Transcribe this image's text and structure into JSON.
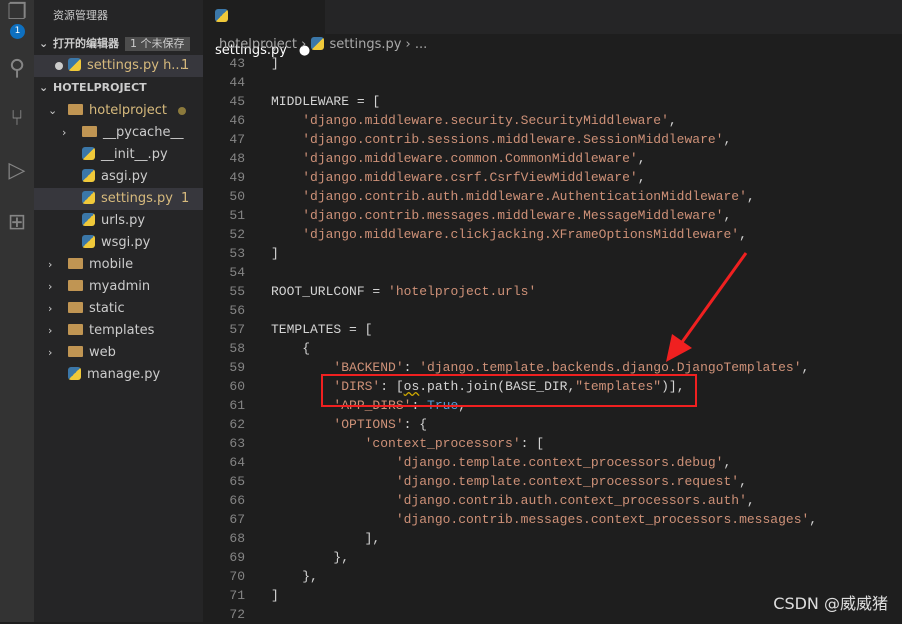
{
  "activity": {
    "badge": "1",
    "icons": [
      "files-icon",
      "search-icon",
      "source-control-icon",
      "run-debug-icon",
      "extensions-icon"
    ]
  },
  "explorer": {
    "title": "资源管理器",
    "open_editors": {
      "label": "打开的编辑器",
      "unsaved": "1 个未保存",
      "items": [
        {
          "name": "settings.py",
          "path": "h...",
          "problems": "1"
        }
      ]
    },
    "project": "HOTELPROJECT",
    "tree": [
      {
        "name": "hotelproject",
        "type": "folder",
        "open": true,
        "depth": 1,
        "modified": true
      },
      {
        "name": "__pycache__",
        "type": "folder",
        "open": false,
        "depth": 2
      },
      {
        "name": "__init__.py",
        "type": "py",
        "depth": 2
      },
      {
        "name": "asgi.py",
        "type": "py",
        "depth": 2
      },
      {
        "name": "settings.py",
        "type": "py",
        "depth": 2,
        "problems": "1",
        "selected": true
      },
      {
        "name": "urls.py",
        "type": "py",
        "depth": 2
      },
      {
        "name": "wsgi.py",
        "type": "py",
        "depth": 2
      },
      {
        "name": "mobile",
        "type": "folder",
        "open": false,
        "depth": 1
      },
      {
        "name": "myadmin",
        "type": "folder",
        "open": false,
        "depth": 1
      },
      {
        "name": "static",
        "type": "folder",
        "open": false,
        "depth": 1
      },
      {
        "name": "templates",
        "type": "folder",
        "open": false,
        "depth": 1
      },
      {
        "name": "web",
        "type": "folder",
        "open": false,
        "depth": 1
      },
      {
        "name": "manage.py",
        "type": "py",
        "depth": 1
      }
    ]
  },
  "tab": {
    "name": "settings.py"
  },
  "breadcrumb": [
    "hotelproject",
    "settings.py",
    "..."
  ],
  "code": [
    {
      "n": "43",
      "t": [
        [
          "",
          "]"
        ]
      ]
    },
    {
      "n": "44",
      "t": []
    },
    {
      "n": "45",
      "t": [
        [
          "",
          "MIDDLEWARE = ["
        ]
      ]
    },
    {
      "n": "46",
      "t": [
        [
          "",
          "    "
        ],
        [
          "s",
          "'django.middleware.security.SecurityMiddleware'"
        ],
        [
          "",
          ","
        ]
      ]
    },
    {
      "n": "47",
      "t": [
        [
          "",
          "    "
        ],
        [
          "s",
          "'django.contrib.sessions.middleware.SessionMiddleware'"
        ],
        [
          "",
          ","
        ]
      ]
    },
    {
      "n": "48",
      "t": [
        [
          "",
          "    "
        ],
        [
          "s",
          "'django.middleware.common.CommonMiddleware'"
        ],
        [
          "",
          ","
        ]
      ]
    },
    {
      "n": "49",
      "t": [
        [
          "",
          "    "
        ],
        [
          "s",
          "'django.middleware.csrf.CsrfViewMiddleware'"
        ],
        [
          "",
          ","
        ]
      ]
    },
    {
      "n": "50",
      "t": [
        [
          "",
          "    "
        ],
        [
          "s",
          "'django.contrib.auth.middleware.AuthenticationMiddleware'"
        ],
        [
          "",
          ","
        ]
      ]
    },
    {
      "n": "51",
      "t": [
        [
          "",
          "    "
        ],
        [
          "s",
          "'django.contrib.messages.middleware.MessageMiddleware'"
        ],
        [
          "",
          ","
        ]
      ]
    },
    {
      "n": "52",
      "t": [
        [
          "",
          "    "
        ],
        [
          "s",
          "'django.middleware.clickjacking.XFrameOptionsMiddleware'"
        ],
        [
          "",
          ","
        ]
      ]
    },
    {
      "n": "53",
      "t": [
        [
          "",
          "]"
        ]
      ]
    },
    {
      "n": "54",
      "t": []
    },
    {
      "n": "55",
      "t": [
        [
          "",
          "ROOT_URLCONF = "
        ],
        [
          "s",
          "'hotelproject.urls'"
        ]
      ]
    },
    {
      "n": "56",
      "t": []
    },
    {
      "n": "57",
      "t": [
        [
          "",
          "TEMPLATES = ["
        ]
      ]
    },
    {
      "n": "58",
      "t": [
        [
          "",
          "    {"
        ]
      ]
    },
    {
      "n": "59",
      "t": [
        [
          "",
          "        "
        ],
        [
          "s",
          "'BACKEND'"
        ],
        [
          "",
          ": "
        ],
        [
          "s",
          "'django.template.backends.django.DjangoTemplates'"
        ],
        [
          "",
          ","
        ]
      ]
    },
    {
      "n": "60",
      "t": [
        [
          "",
          "        "
        ],
        [
          "s",
          "'DIRS'"
        ],
        [
          "",
          ": ["
        ],
        [
          "w",
          "os"
        ],
        [
          "",
          ".path.join(BASE_DIR,"
        ],
        [
          "s",
          "\"templates\""
        ],
        [
          "",
          ")],"
        ]
      ]
    },
    {
      "n": "61",
      "t": [
        [
          "",
          "        "
        ],
        [
          "s",
          "'APP_DIRS'"
        ],
        [
          "",
          ": "
        ],
        [
          "k",
          "True"
        ],
        [
          "",
          ","
        ]
      ]
    },
    {
      "n": "62",
      "t": [
        [
          "",
          "        "
        ],
        [
          "s",
          "'OPTIONS'"
        ],
        [
          "",
          ": {"
        ]
      ]
    },
    {
      "n": "63",
      "t": [
        [
          "",
          "            "
        ],
        [
          "s",
          "'context_processors'"
        ],
        [
          "",
          ": ["
        ]
      ]
    },
    {
      "n": "64",
      "t": [
        [
          "",
          "                "
        ],
        [
          "s",
          "'django.template.context_processors.debug'"
        ],
        [
          "",
          ","
        ]
      ]
    },
    {
      "n": "65",
      "t": [
        [
          "",
          "                "
        ],
        [
          "s",
          "'django.template.context_processors.request'"
        ],
        [
          "",
          ","
        ]
      ]
    },
    {
      "n": "66",
      "t": [
        [
          "",
          "                "
        ],
        [
          "s",
          "'django.contrib.auth.context_processors.auth'"
        ],
        [
          "",
          ","
        ]
      ]
    },
    {
      "n": "67",
      "t": [
        [
          "",
          "                "
        ],
        [
          "s",
          "'django.contrib.messages.context_processors.messages'"
        ],
        [
          "",
          ","
        ]
      ]
    },
    {
      "n": "68",
      "t": [
        [
          "",
          "            ],"
        ]
      ]
    },
    {
      "n": "69",
      "t": [
        [
          "",
          "        },"
        ]
      ]
    },
    {
      "n": "70",
      "t": [
        [
          "",
          "    },"
        ]
      ]
    },
    {
      "n": "71",
      "t": [
        [
          "",
          "]"
        ]
      ]
    },
    {
      "n": "72",
      "t": []
    }
  ],
  "annotation_color": "#f02020",
  "watermark": "CSDN @威威猪"
}
